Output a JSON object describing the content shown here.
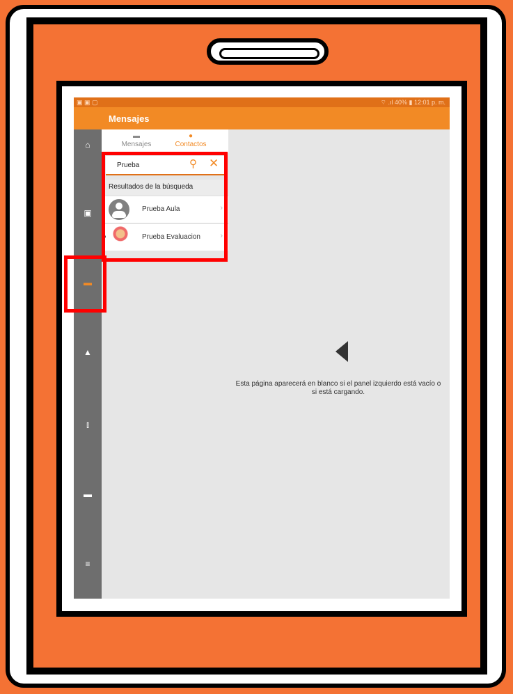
{
  "status_bar": {
    "left_icons": "▣ ▣ ▢",
    "right": "⌔ .ıl 40% ▮ 12:01 p. m."
  },
  "app_bar": {
    "title": "Mensajes"
  },
  "sidebar": {
    "items": [
      {
        "icon": "home-icon",
        "glyph": "⌂"
      },
      {
        "icon": "calendar-icon",
        "glyph": "▣"
      },
      {
        "icon": "chat-icon",
        "glyph": "▬"
      },
      {
        "icon": "bell-icon",
        "glyph": "▲"
      },
      {
        "icon": "chart-icon",
        "glyph": "⫾"
      },
      {
        "icon": "folder-icon",
        "glyph": "▬"
      },
      {
        "icon": "menu-icon",
        "glyph": "≡"
      }
    ]
  },
  "tabs": {
    "mensajes": {
      "label": "Mensajes",
      "glyph": "▬"
    },
    "contactos": {
      "label": "Contactos",
      "glyph": "●"
    }
  },
  "search": {
    "value": "Prueba",
    "search_glyph": "⚲",
    "close_glyph": "✕"
  },
  "results": {
    "header": "Resultados de la búsqueda",
    "items": [
      {
        "name": "Prueba Aula"
      },
      {
        "name": "Prueba Evaluacion"
      }
    ],
    "chevron": "›"
  },
  "detail": {
    "back_icon": "back-arrow-icon",
    "message": "Esta página aparecerá en blanco si el panel izquierdo está vacío o si está cargando."
  },
  "colors": {
    "accent": "#f28a25",
    "highlight": "#ff0000",
    "background": "#f47234"
  }
}
